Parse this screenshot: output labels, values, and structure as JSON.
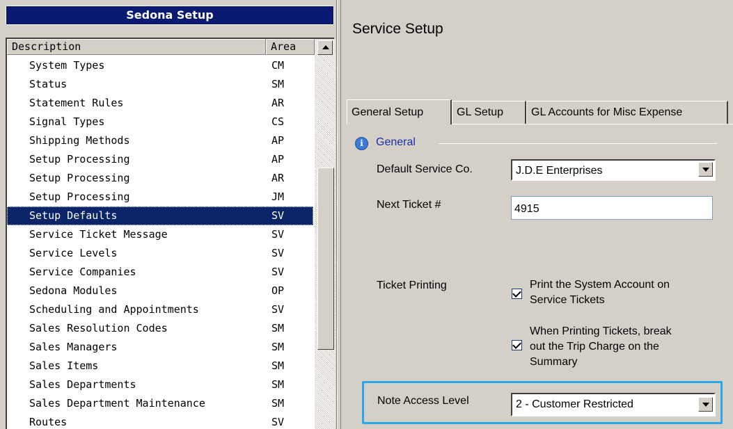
{
  "left_panel": {
    "title": "Sedona Setup",
    "columns": {
      "description": "Description",
      "area": "Area"
    },
    "rows": [
      {
        "description": "System Types",
        "area": "CM"
      },
      {
        "description": "Status",
        "area": "SM"
      },
      {
        "description": "Statement Rules",
        "area": "AR"
      },
      {
        "description": "Signal Types",
        "area": "CS"
      },
      {
        "description": "Shipping Methods",
        "area": "AP"
      },
      {
        "description": "Setup Processing",
        "area": "AP"
      },
      {
        "description": "Setup Processing",
        "area": "AR"
      },
      {
        "description": "Setup Processing",
        "area": "JM"
      },
      {
        "description": "Setup Defaults",
        "area": "SV",
        "selected": true
      },
      {
        "description": "Service Ticket Message",
        "area": "SV"
      },
      {
        "description": "Service Levels",
        "area": "SV"
      },
      {
        "description": "Service Companies",
        "area": "SV"
      },
      {
        "description": "Sedona Modules",
        "area": "OP"
      },
      {
        "description": "Scheduling and Appointments",
        "area": "SV"
      },
      {
        "description": "Sales Resolution Codes",
        "area": "SM"
      },
      {
        "description": "Sales Managers",
        "area": "SM"
      },
      {
        "description": "Sales Items",
        "area": "SM"
      },
      {
        "description": "Sales Departments",
        "area": "SM"
      },
      {
        "description": "Sales Department Maintenance",
        "area": "SM"
      },
      {
        "description": "Routes",
        "area": "SV"
      }
    ]
  },
  "right_panel": {
    "title": "Service Setup",
    "tabs": [
      "General Setup",
      "GL Setup",
      "GL Accounts for Misc Expense"
    ],
    "active_tab": "General Setup",
    "section": {
      "title": "General",
      "icon": "info-icon"
    },
    "fields": {
      "default_service_co": {
        "label": "Default Service Co.",
        "value": "J.D.E Enterprises"
      },
      "next_ticket": {
        "label": "Next Ticket #",
        "value": "4915"
      },
      "ticket_printing": {
        "label": "Ticket Printing",
        "print_system_account": {
          "text": "Print the System Account on\nService Tickets",
          "checked": true
        },
        "break_out_trip_charge": {
          "text": "When Printing Tickets, break\nout the Trip Charge on the\nSummary",
          "checked": true
        }
      },
      "note_access_level": {
        "label": "Note Access Level",
        "value": "2 - Customer Restricted"
      }
    }
  },
  "colors": {
    "title_bar": "#0a1a73",
    "selection": "#0a246a",
    "section_title": "#1a31a8",
    "highlight_border": "#29a7e8"
  }
}
